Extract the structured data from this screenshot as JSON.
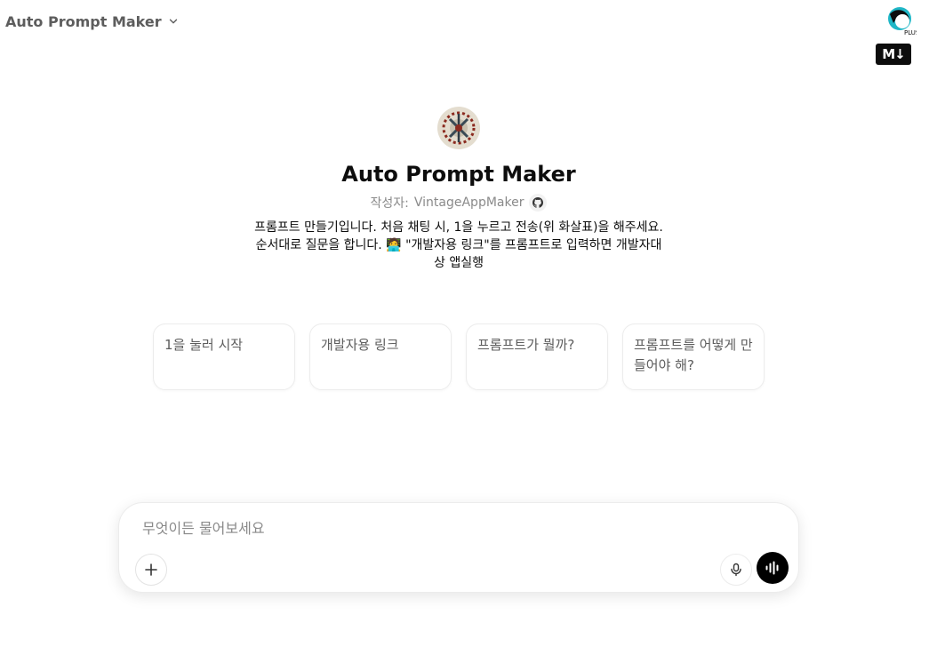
{
  "header": {
    "title": "Auto Prompt Maker",
    "plus_badge": "PLUS",
    "markdown_badge": "M↓"
  },
  "gpt": {
    "name": "Auto Prompt Maker",
    "author_prefix": "작성자:",
    "author_name": "VintageAppMaker",
    "description": "프롬프트 만들기입니다. 처음 채팅 시, 1을 누르고 전송(위 화살표)을 해주세요. 순서대로 질문을 합니다. 🧑‍💻 \"개발자용 링크\"를 프롬프트로 입력하면 개발자대상 앱실행"
  },
  "starters": [
    {
      "label": "1을 눌러 시작"
    },
    {
      "label": "개발자용 링크"
    },
    {
      "label": "프롬프트가 뭘까?"
    },
    {
      "label": "프롬프트를 어떻게 만들어야 해?"
    }
  ],
  "composer": {
    "placeholder": "무엇이든 물어보세요"
  },
  "icons": {
    "dropdown": "chevron-down-icon",
    "github": "github-icon",
    "add": "plus-icon",
    "mic": "microphone-icon",
    "voice": "voice-waveform-icon"
  }
}
